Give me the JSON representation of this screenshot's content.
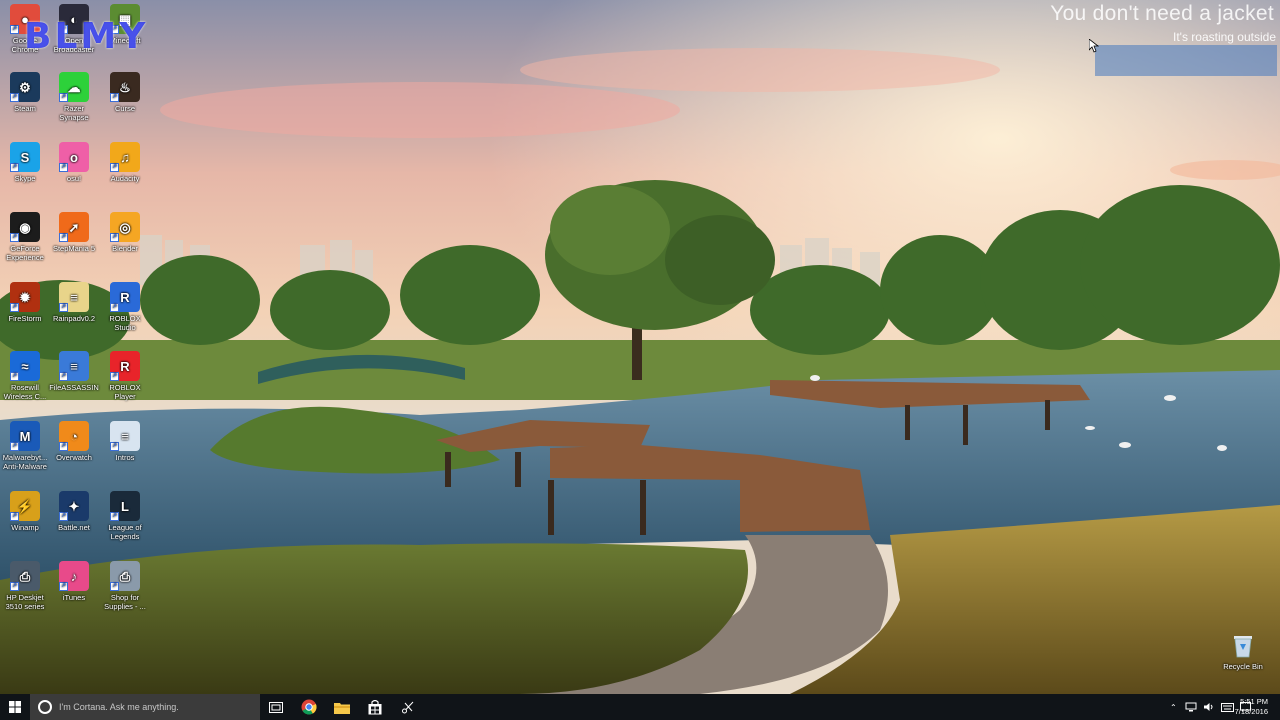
{
  "overlay": {
    "title": "You don't need a jacket",
    "subtitle": "It's roasting outside"
  },
  "watermark": "BLMY",
  "desktop_icons": [
    {
      "id": "chrome",
      "label": "Google Chrome",
      "icon": "chrome-icon",
      "color": "#e14c3c"
    },
    {
      "id": "obs",
      "label": "Open Broadcaster",
      "icon": "obs-icon",
      "color": "#2a2a3a"
    },
    {
      "id": "minecraft",
      "label": "Minecraft",
      "icon": "minecraft-icon",
      "color": "#5b8c32"
    },
    {
      "id": "steam",
      "label": "Steam",
      "icon": "steam-icon",
      "color": "#1b3a5c"
    },
    {
      "id": "razer",
      "label": "Razer Synapse",
      "icon": "razer-cloud-icon",
      "color": "#2dd13a"
    },
    {
      "id": "curse",
      "label": "Curse",
      "icon": "curse-icon",
      "color": "#3a2a20"
    },
    {
      "id": "skype",
      "label": "Skype",
      "icon": "skype-icon",
      "color": "#1aa3e8"
    },
    {
      "id": "osu",
      "label": "osu!",
      "icon": "osu-icon",
      "color": "#ef5fa7"
    },
    {
      "id": "audacity",
      "label": "Audacity",
      "icon": "audacity-icon",
      "color": "#f2a81a"
    },
    {
      "id": "geforce",
      "label": "GeForce Experience",
      "icon": "nvidia-icon",
      "color": "#1c1c1c"
    },
    {
      "id": "stepmania",
      "label": "StepMania 5",
      "icon": "stepmania-icon",
      "color": "#f06a1a"
    },
    {
      "id": "blender",
      "label": "Blender",
      "icon": "blender-icon",
      "color": "#f5a623"
    },
    {
      "id": "firestorm",
      "label": "FireStorm",
      "icon": "firestorm-icon",
      "color": "#b03010"
    },
    {
      "id": "rainpad",
      "label": "Rainpadv0.2",
      "icon": "file-icon",
      "color": "#e8d48a"
    },
    {
      "id": "roblox-studio",
      "label": "ROBLOX Studio",
      "icon": "roblox-studio-icon",
      "color": "#2a6ad8"
    },
    {
      "id": "rosewill",
      "label": "Rosewill Wireless C...",
      "icon": "wireless-icon",
      "color": "#1a6ad8"
    },
    {
      "id": "fileassassin",
      "label": "FileASSASSIN",
      "icon": "file-icon",
      "color": "#3a7ad8"
    },
    {
      "id": "roblox-player",
      "label": "ROBLOX Player",
      "icon": "roblox-icon",
      "color": "#e8242a"
    },
    {
      "id": "malwarebytes",
      "label": "Malwarebyt... Anti-Malware",
      "icon": "malwarebytes-icon",
      "color": "#1a5ab8"
    },
    {
      "id": "overwatch",
      "label": "Overwatch",
      "icon": "overwatch-icon",
      "color": "#f08a1a"
    },
    {
      "id": "intros",
      "label": "Intros",
      "icon": "file-icon",
      "color": "#d8e4f0"
    },
    {
      "id": "winamp",
      "label": "Winamp",
      "icon": "winamp-icon",
      "color": "#d8a01a"
    },
    {
      "id": "battlenet",
      "label": "Battle.net",
      "icon": "battlenet-icon",
      "color": "#1a3a6a"
    },
    {
      "id": "lol",
      "label": "League of Legends",
      "icon": "league-icon",
      "color": "#1a2a3a"
    },
    {
      "id": "hp-deskjet",
      "label": "HP Deskjet 3510 series",
      "icon": "printer-icon",
      "color": "#4a5a6a"
    },
    {
      "id": "itunes",
      "label": "iTunes",
      "icon": "itunes-icon",
      "color": "#e84a8a"
    },
    {
      "id": "shop-supplies",
      "label": "Shop for Supplies - ...",
      "icon": "printer-icon",
      "color": "#8a9aaa"
    }
  ],
  "recycle_bin": {
    "label": "Recycle Bin"
  },
  "taskbar": {
    "search_placeholder": "I'm Cortana. Ask me anything.",
    "time": "5:51 PM",
    "date": "7/18/2016"
  }
}
